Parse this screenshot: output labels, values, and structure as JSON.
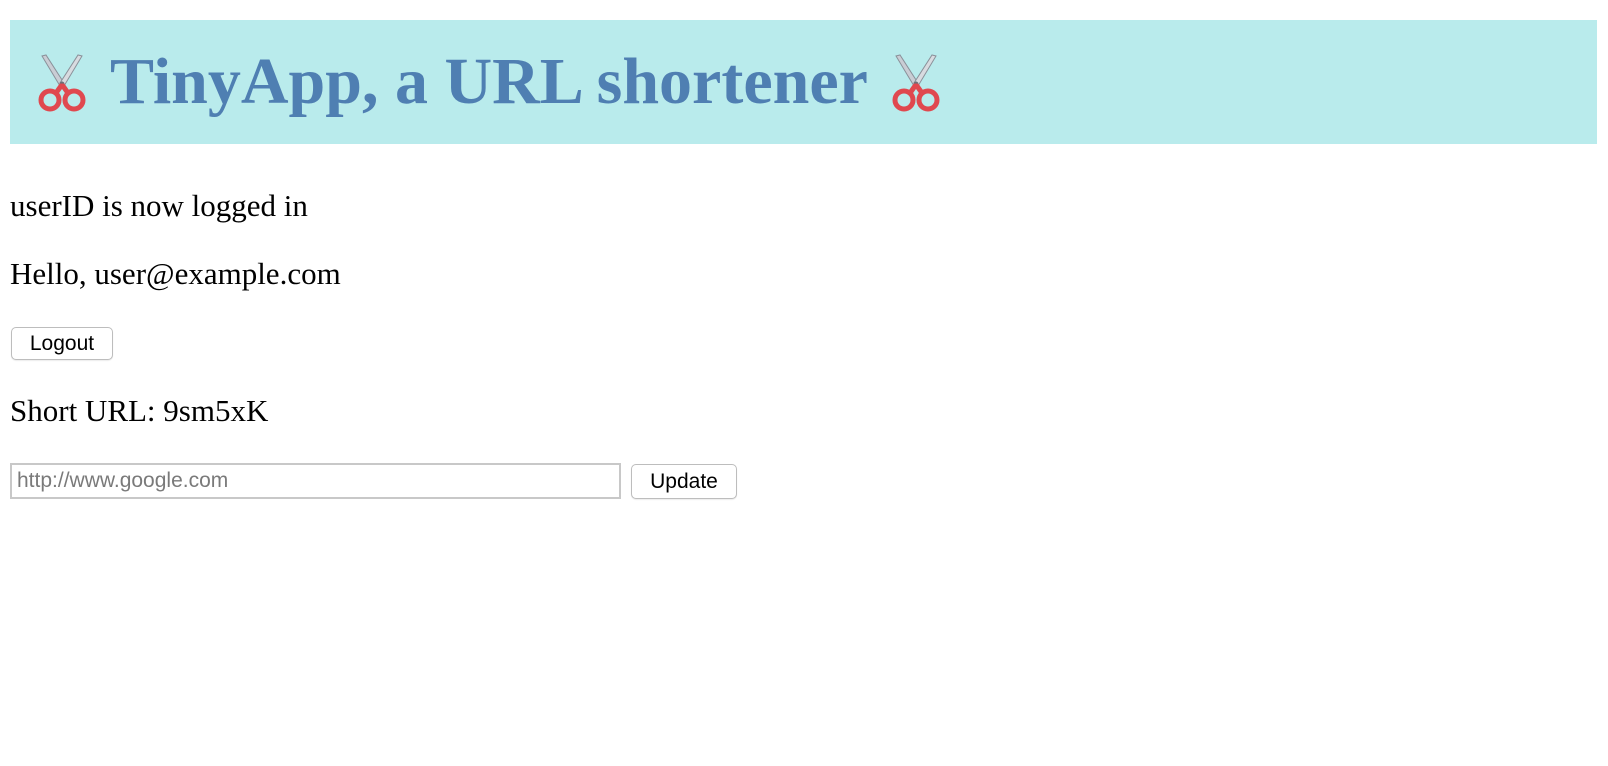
{
  "header": {
    "title": "TinyApp, a URL shortener",
    "left_icon": "scissors-icon",
    "right_icon": "scissors-icon",
    "background_color": "#b9ebec",
    "title_color": "#4f7fb2"
  },
  "status": {
    "login_message": "userID is now logged in",
    "greeting": "Hello, user@example.com"
  },
  "buttons": {
    "logout_label": "Logout",
    "update_label": "Update"
  },
  "short_url": {
    "text": "Short URL: 9sm5xK"
  },
  "form": {
    "url_placeholder": "http://www.google.com",
    "url_value": ""
  }
}
